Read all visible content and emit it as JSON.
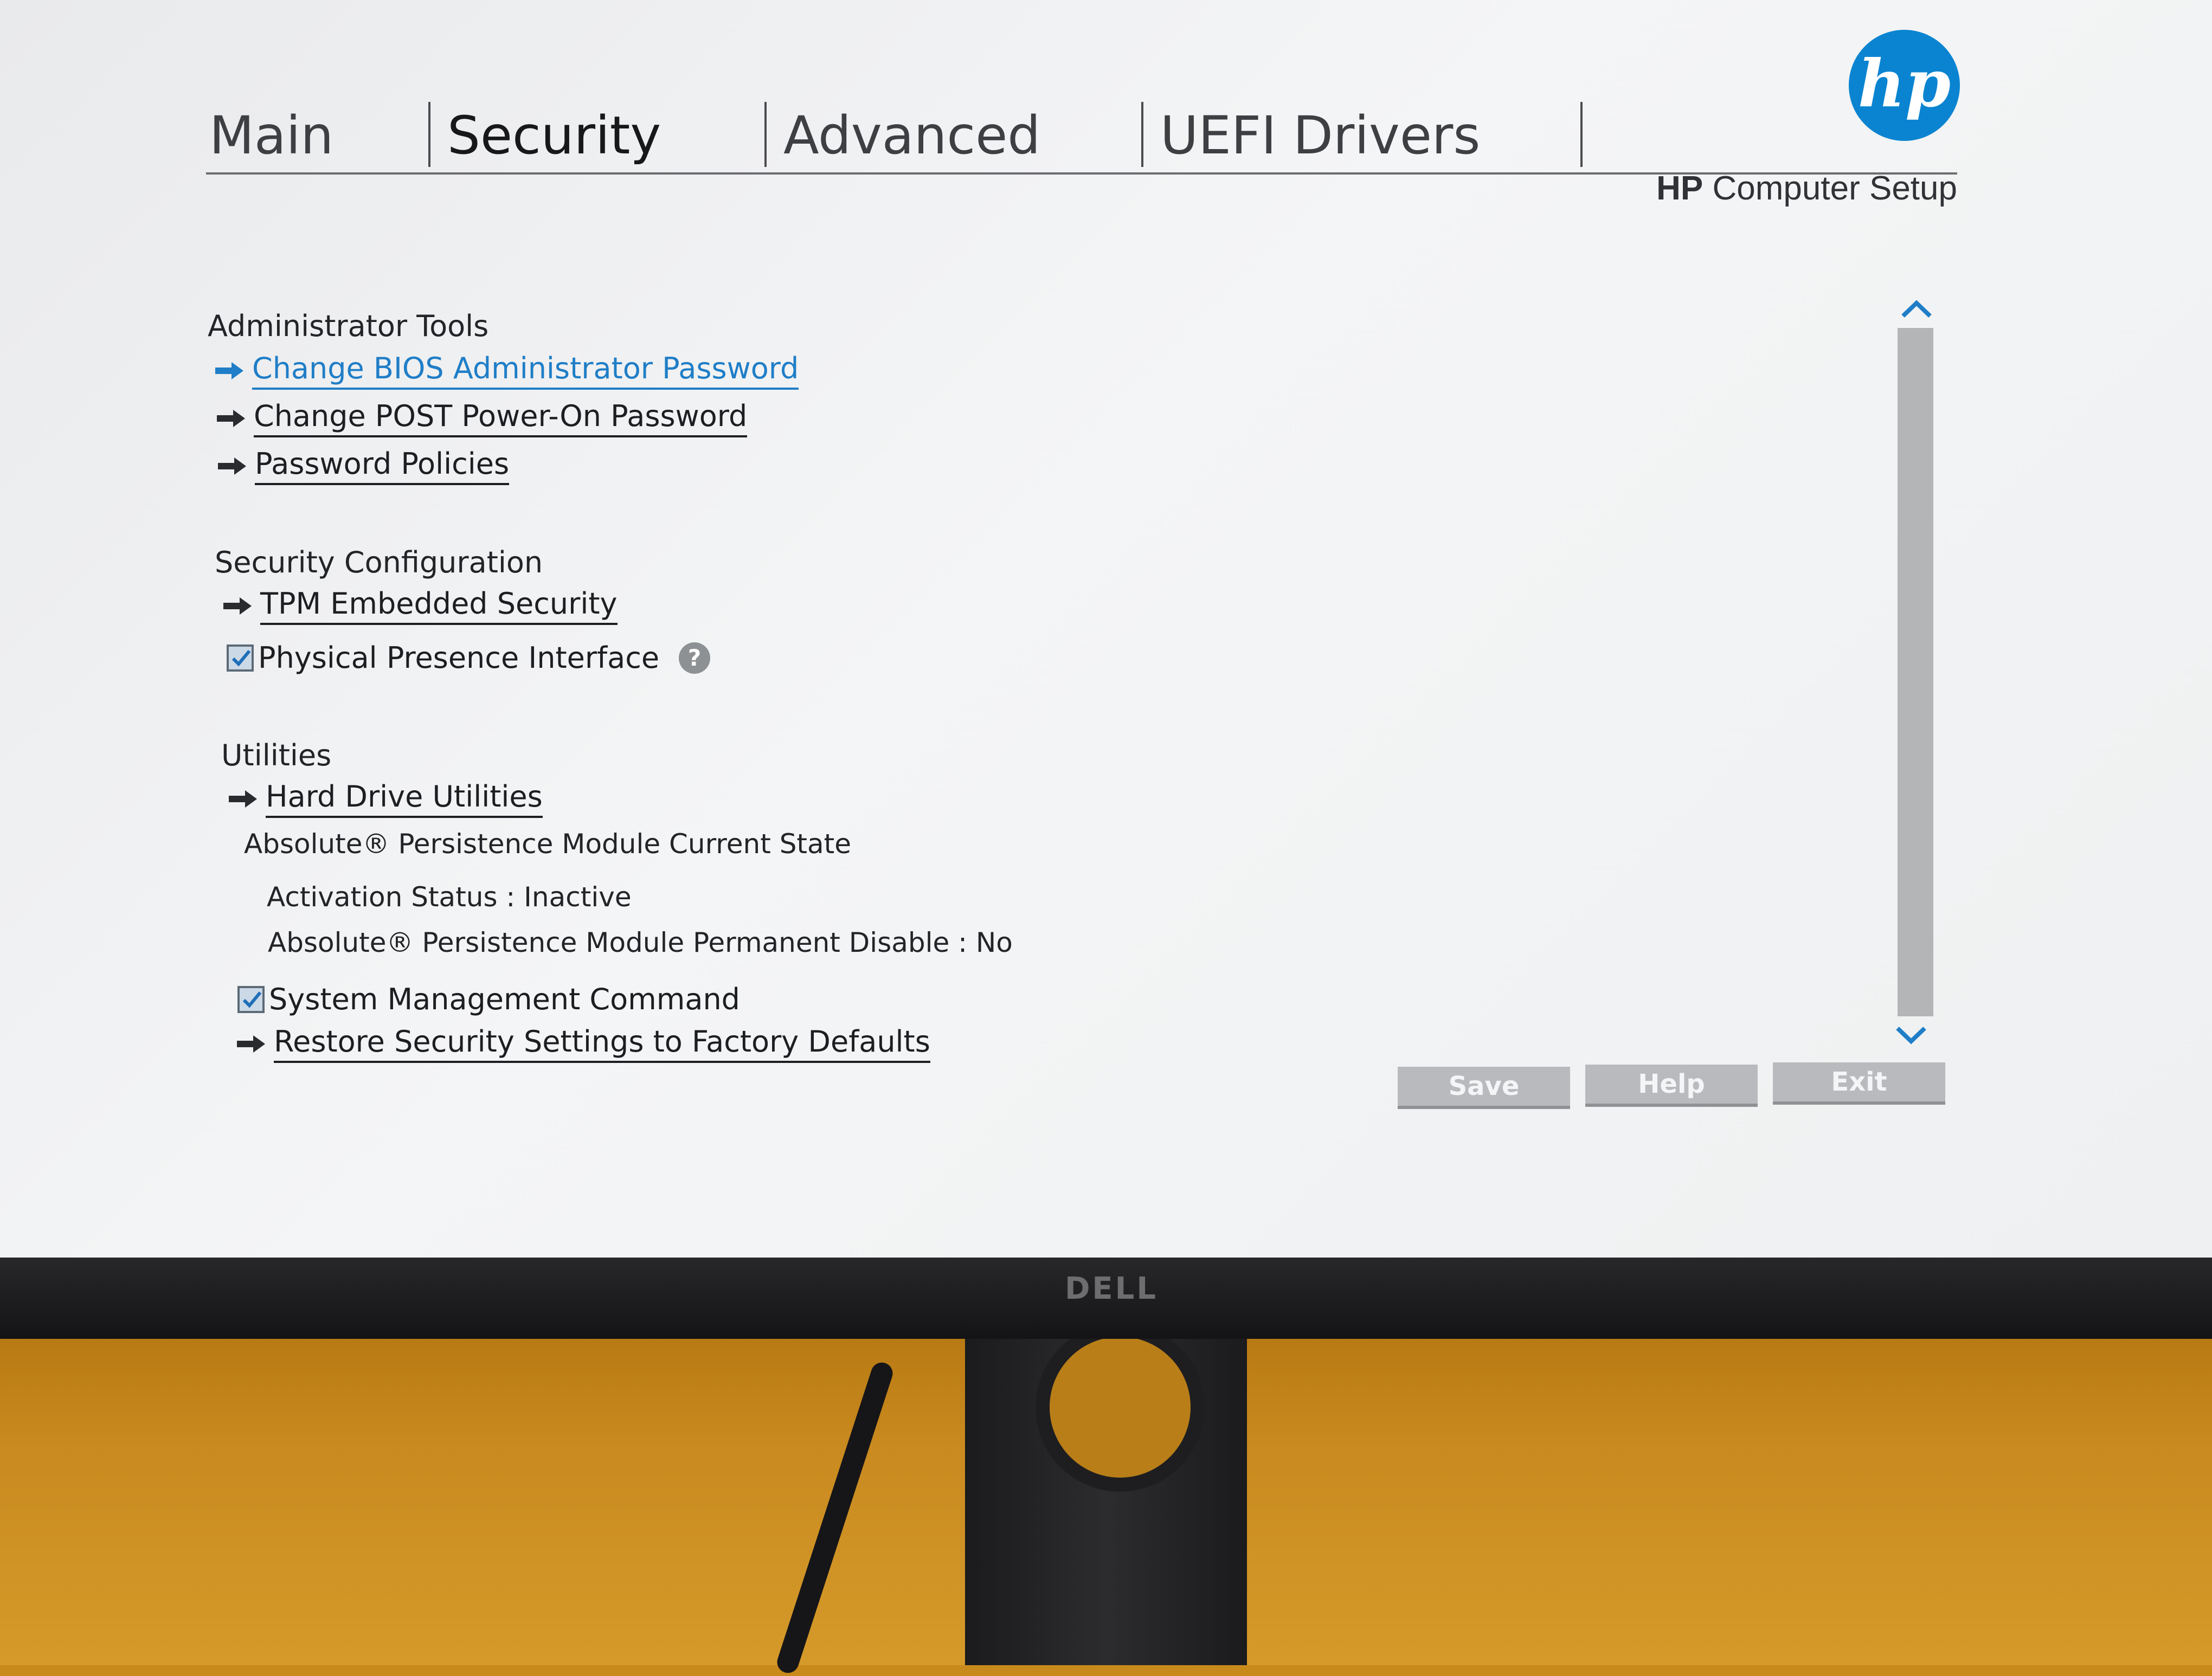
{
  "tabs": [
    {
      "label": "Main",
      "active": false
    },
    {
      "label": "Security",
      "active": true
    },
    {
      "label": "Advanced",
      "active": false
    },
    {
      "label": "UEFI Drivers",
      "active": false
    }
  ],
  "brand": {
    "logo_text": "hp",
    "product_bold": "HP",
    "product_rest": " Computer Setup",
    "logo_color": "#0a84d1"
  },
  "sections": {
    "admin_tools": {
      "title": "Administrator Tools",
      "items": [
        {
          "label": "Change BIOS Administrator Password",
          "highlighted": true
        },
        {
          "label": "Change POST Power-On Password"
        },
        {
          "label": "Password Policies"
        }
      ]
    },
    "security_config": {
      "title": "Security Configuration",
      "tpm_label": "TPM Embedded Security",
      "ppi_label": "Physical Presence Interface",
      "ppi_checked": true
    },
    "utilities": {
      "title": "Utilities",
      "hdd_label": "Hard Drive Utilities",
      "absolute_state_label": "Absolute® Persistence Module Current State",
      "activation_status": "Activation Status : Inactive",
      "permanent_disable": "Absolute® Persistence Module Permanent Disable : No",
      "smc_label": "System Management Command",
      "smc_checked": true,
      "restore_label": "Restore Security Settings to Factory Defaults"
    }
  },
  "buttons": {
    "save": "Save",
    "help": "Help",
    "exit": "Exit"
  },
  "icons": {
    "arrow": "arrow-right-icon",
    "help": "question-icon",
    "scroll_up": "chevron-up-icon",
    "scroll_down": "chevron-down-icon"
  },
  "colors": {
    "link_highlight": "#1f7ec7",
    "text": "#1d1e21"
  },
  "monitor": {
    "brand": "DELL"
  }
}
